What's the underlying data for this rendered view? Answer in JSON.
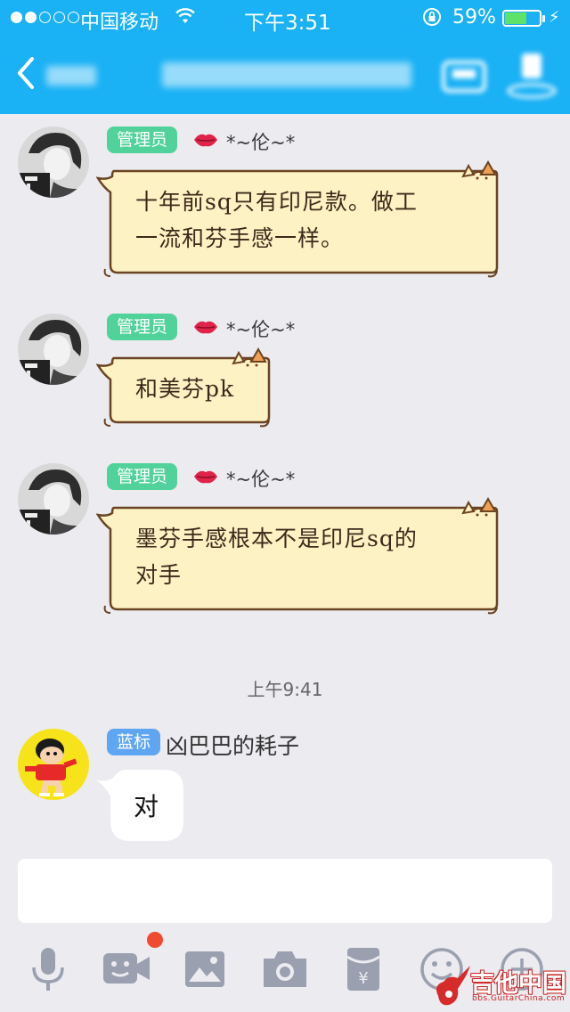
{
  "status_bar": {
    "carrier": "中国移动",
    "time": "下午3:51",
    "battery_percent": "59%",
    "battery_level": 0.59,
    "signal_bars_filled": 2,
    "signal_bars_total": 5
  },
  "nav": {
    "back_icon": "chevron-left-icon",
    "title_blurred": true,
    "right_icons": [
      "group-profile-icon",
      "person-icon"
    ]
  },
  "messages": [
    {
      "sender": "*~伦~*",
      "badge": "管理员",
      "text_line1": "十年前sq只有印尼款。做工",
      "text_line2": "一流和芬手感一样。"
    },
    {
      "sender": "*~伦~*",
      "badge": "管理员",
      "text_line1": "和美芬pk"
    },
    {
      "sender": "*~伦~*",
      "badge": "管理员",
      "text_line1": "墨芬手感根本不是印尼sq的",
      "text_line2": "对手"
    }
  ],
  "timestamp": "上午9:41",
  "last_message": {
    "badge": "蓝标",
    "sender": "凶巴巴的耗子",
    "text": "对"
  },
  "toolbar": {
    "icons": [
      "microphone-icon",
      "video-call-icon",
      "image-icon",
      "camera-icon",
      "red-packet-icon",
      "emoji-icon",
      "plus-icon"
    ],
    "video_has_notification": true
  },
  "watermark": {
    "text": "吉他中国",
    "url": "bbs.GuitarChina.com"
  },
  "colors": {
    "nav_bg": "#1ab1f5",
    "admin_badge": "#51d29a",
    "blue_badge": "#5fa6f2",
    "bubble_fill": "#fdf2c4",
    "bubble_stroke": "#6b4423",
    "chat_bg": "#ebebf0"
  }
}
